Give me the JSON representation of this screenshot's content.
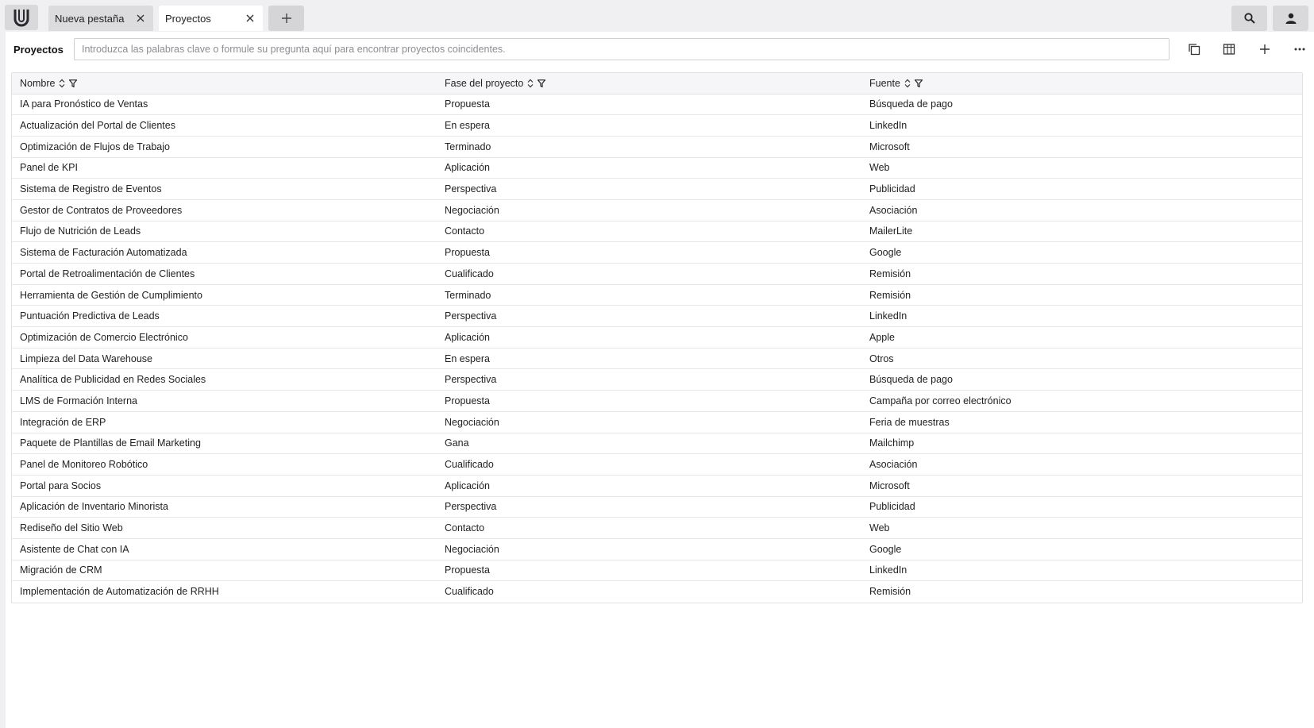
{
  "tabs": [
    {
      "label": "Nueva pestaña"
    },
    {
      "label": "Proyectos"
    }
  ],
  "icons": {
    "logo": "u-logo-icon",
    "close": "close-icon",
    "add": "plus-icon",
    "search": "search-icon",
    "user": "user-icon",
    "copy": "copy-icon",
    "board": "board-view-icon",
    "more": "more-icon",
    "sort": "sort-icon",
    "filter": "filter-icon"
  },
  "toolbar": {
    "title": "Proyectos",
    "search_placeholder": "Introduzca las palabras clave o formule su pregunta aquí para encontrar proyectos coincidentes."
  },
  "table": {
    "columns": [
      "Nombre",
      "Fase del proyecto",
      "Fuente"
    ],
    "rows": [
      [
        "IA para Pronóstico de Ventas",
        "Propuesta",
        "Búsqueda de pago"
      ],
      [
        "Actualización del Portal de Clientes",
        "En espera",
        "LinkedIn"
      ],
      [
        "Optimización de Flujos de Trabajo",
        "Terminado",
        "Microsoft"
      ],
      [
        "Panel de KPI",
        "Aplicación",
        "Web"
      ],
      [
        "Sistema de Registro de Eventos",
        "Perspectiva",
        "Publicidad"
      ],
      [
        "Gestor de Contratos de Proveedores",
        "Negociación",
        "Asociación"
      ],
      [
        "Flujo de Nutrición de Leads",
        "Contacto",
        "MailerLite"
      ],
      [
        "Sistema de Facturación Automatizada",
        "Propuesta",
        "Google"
      ],
      [
        "Portal de Retroalimentación de Clientes",
        "Cualificado",
        "Remisión"
      ],
      [
        "Herramienta de Gestión de Cumplimiento",
        "Terminado",
        "Remisión"
      ],
      [
        "Puntuación Predictiva de Leads",
        "Perspectiva",
        "LinkedIn"
      ],
      [
        "Optimización de Comercio Electrónico",
        "Aplicación",
        "Apple"
      ],
      [
        "Limpieza del Data Warehouse",
        "En espera",
        "Otros"
      ],
      [
        "Analítica de Publicidad en Redes Sociales",
        "Perspectiva",
        "Búsqueda de pago"
      ],
      [
        "LMS de Formación Interna",
        "Propuesta",
        "Campaña por correo electrónico"
      ],
      [
        "Integración de ERP",
        "Negociación",
        "Feria de muestras"
      ],
      [
        "Paquete de Plantillas de Email Marketing",
        "Gana",
        "Mailchimp"
      ],
      [
        "Panel de Monitoreo Robótico",
        "Cualificado",
        "Asociación"
      ],
      [
        "Portal para Socios",
        "Aplicación",
        "Microsoft"
      ],
      [
        "Aplicación de Inventario Minorista",
        "Perspectiva",
        "Publicidad"
      ],
      [
        "Rediseño del Sitio Web",
        "Contacto",
        "Web"
      ],
      [
        "Asistente de Chat con IA",
        "Negociación",
        "Google"
      ],
      [
        "Migración de CRM",
        "Propuesta",
        "LinkedIn"
      ],
      [
        "Implementación de Automatización de RRHH",
        "Cualificado",
        "Remisión"
      ]
    ]
  }
}
